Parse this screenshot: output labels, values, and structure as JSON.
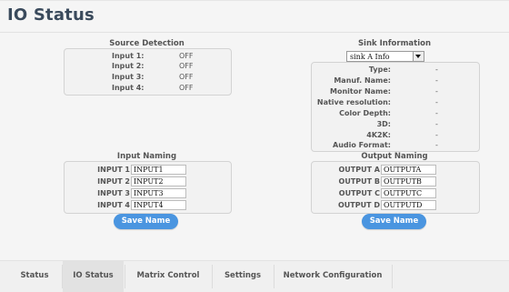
{
  "page": {
    "title": "IO Status"
  },
  "source_detection": {
    "heading": "Source Detection",
    "inputs": [
      {
        "label": "Input 1:",
        "value": "OFF"
      },
      {
        "label": "Input 2:",
        "value": "OFF"
      },
      {
        "label": "Input 3:",
        "value": "OFF"
      },
      {
        "label": "Input 4:",
        "value": "OFF"
      }
    ]
  },
  "sink_information": {
    "heading": "Sink Information",
    "selected_sink": "sink A Info",
    "fields": [
      {
        "label": "Type:",
        "value": "-"
      },
      {
        "label": "Manuf. Name:",
        "value": "-"
      },
      {
        "label": "Monitor Name:",
        "value": "-"
      },
      {
        "label": "Native resolution:",
        "value": "-"
      },
      {
        "label": "Color Depth:",
        "value": "-"
      },
      {
        "label": "3D:",
        "value": "-"
      },
      {
        "label": "4K2K:",
        "value": "-"
      },
      {
        "label": "Audio Format:",
        "value": "-"
      }
    ]
  },
  "input_naming": {
    "heading": "Input Naming",
    "rows": [
      {
        "label": "INPUT 1",
        "value": "INPUT1"
      },
      {
        "label": "INPUT 2",
        "value": "INPUT2"
      },
      {
        "label": "INPUT 3",
        "value": "INPUT3"
      },
      {
        "label": "INPUT 4",
        "value": "INPUT4"
      }
    ],
    "save_label": "Save Name"
  },
  "output_naming": {
    "heading": "Output Naming",
    "rows": [
      {
        "label": "OUTPUT A",
        "value": "OUTPUTA"
      },
      {
        "label": "OUTPUT B",
        "value": "OUTPUTB"
      },
      {
        "label": "OUTPUT C",
        "value": "OUTPUTC"
      },
      {
        "label": "OUTPUT D",
        "value": "OUTPUTD"
      }
    ],
    "save_label": "Save Name"
  },
  "tabs": [
    {
      "label": "Status",
      "active": false
    },
    {
      "label": "IO Status",
      "active": true
    },
    {
      "label": "Matrix Control",
      "active": false
    },
    {
      "label": "Settings",
      "active": false
    },
    {
      "label": "Network Configuration",
      "active": false
    }
  ],
  "colors": {
    "accent": "#4a95e0",
    "title": "#3a4a5c",
    "active_tab": "#e2e2e2"
  }
}
